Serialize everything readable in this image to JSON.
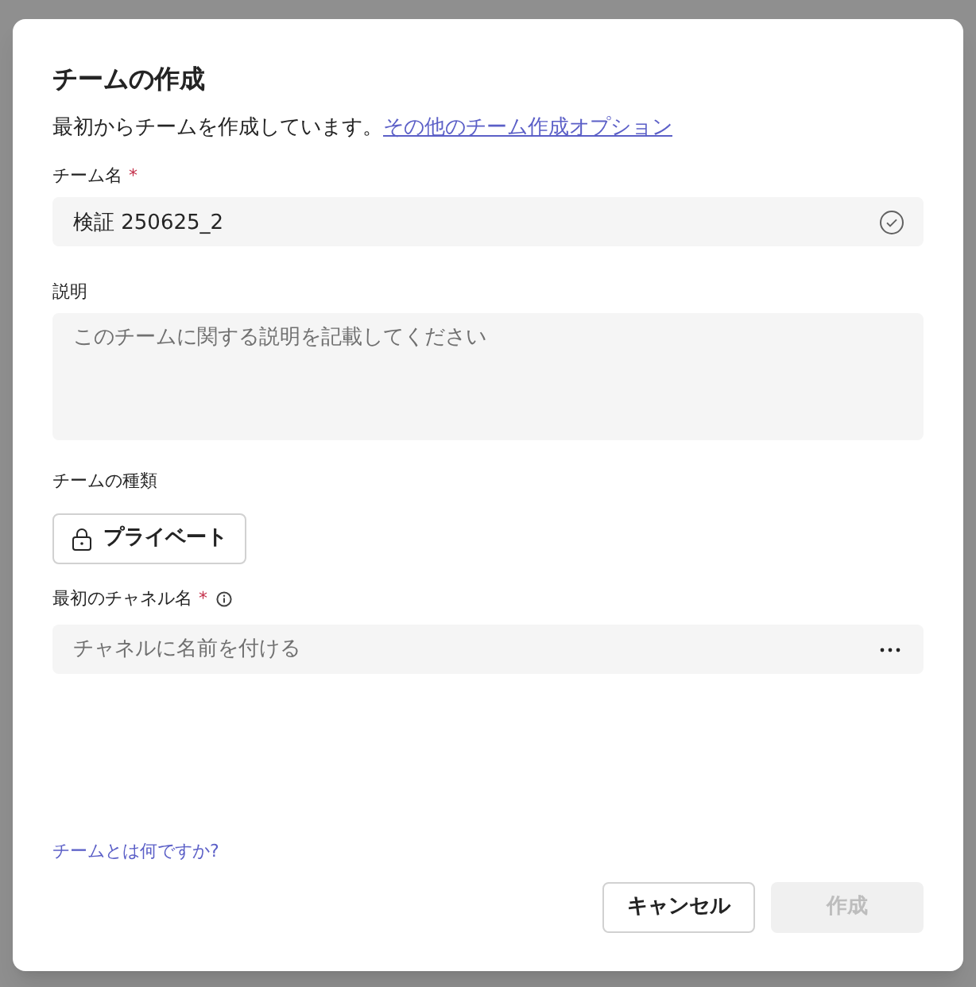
{
  "dialog": {
    "title": "チームの作成",
    "intro": "最初からチームを作成しています。",
    "intro_link": "その他のチーム作成オプション",
    "team_name": {
      "label": "チーム名",
      "required_mark": "*",
      "value": "検証 250625_2"
    },
    "description": {
      "label": "説明",
      "placeholder": "このチームに関する説明を記載してください"
    },
    "team_type": {
      "label": "チームの種類",
      "button": "プライベート"
    },
    "channel_name": {
      "label": "最初のチャネル名",
      "required_mark": "*",
      "placeholder": "チャネルに名前を付ける"
    },
    "help_link": "チームとは何ですか?",
    "buttons": [
      {
        "label": "キャンセル",
        "disabled": false
      },
      {
        "label": "作成",
        "disabled": true
      }
    ]
  }
}
